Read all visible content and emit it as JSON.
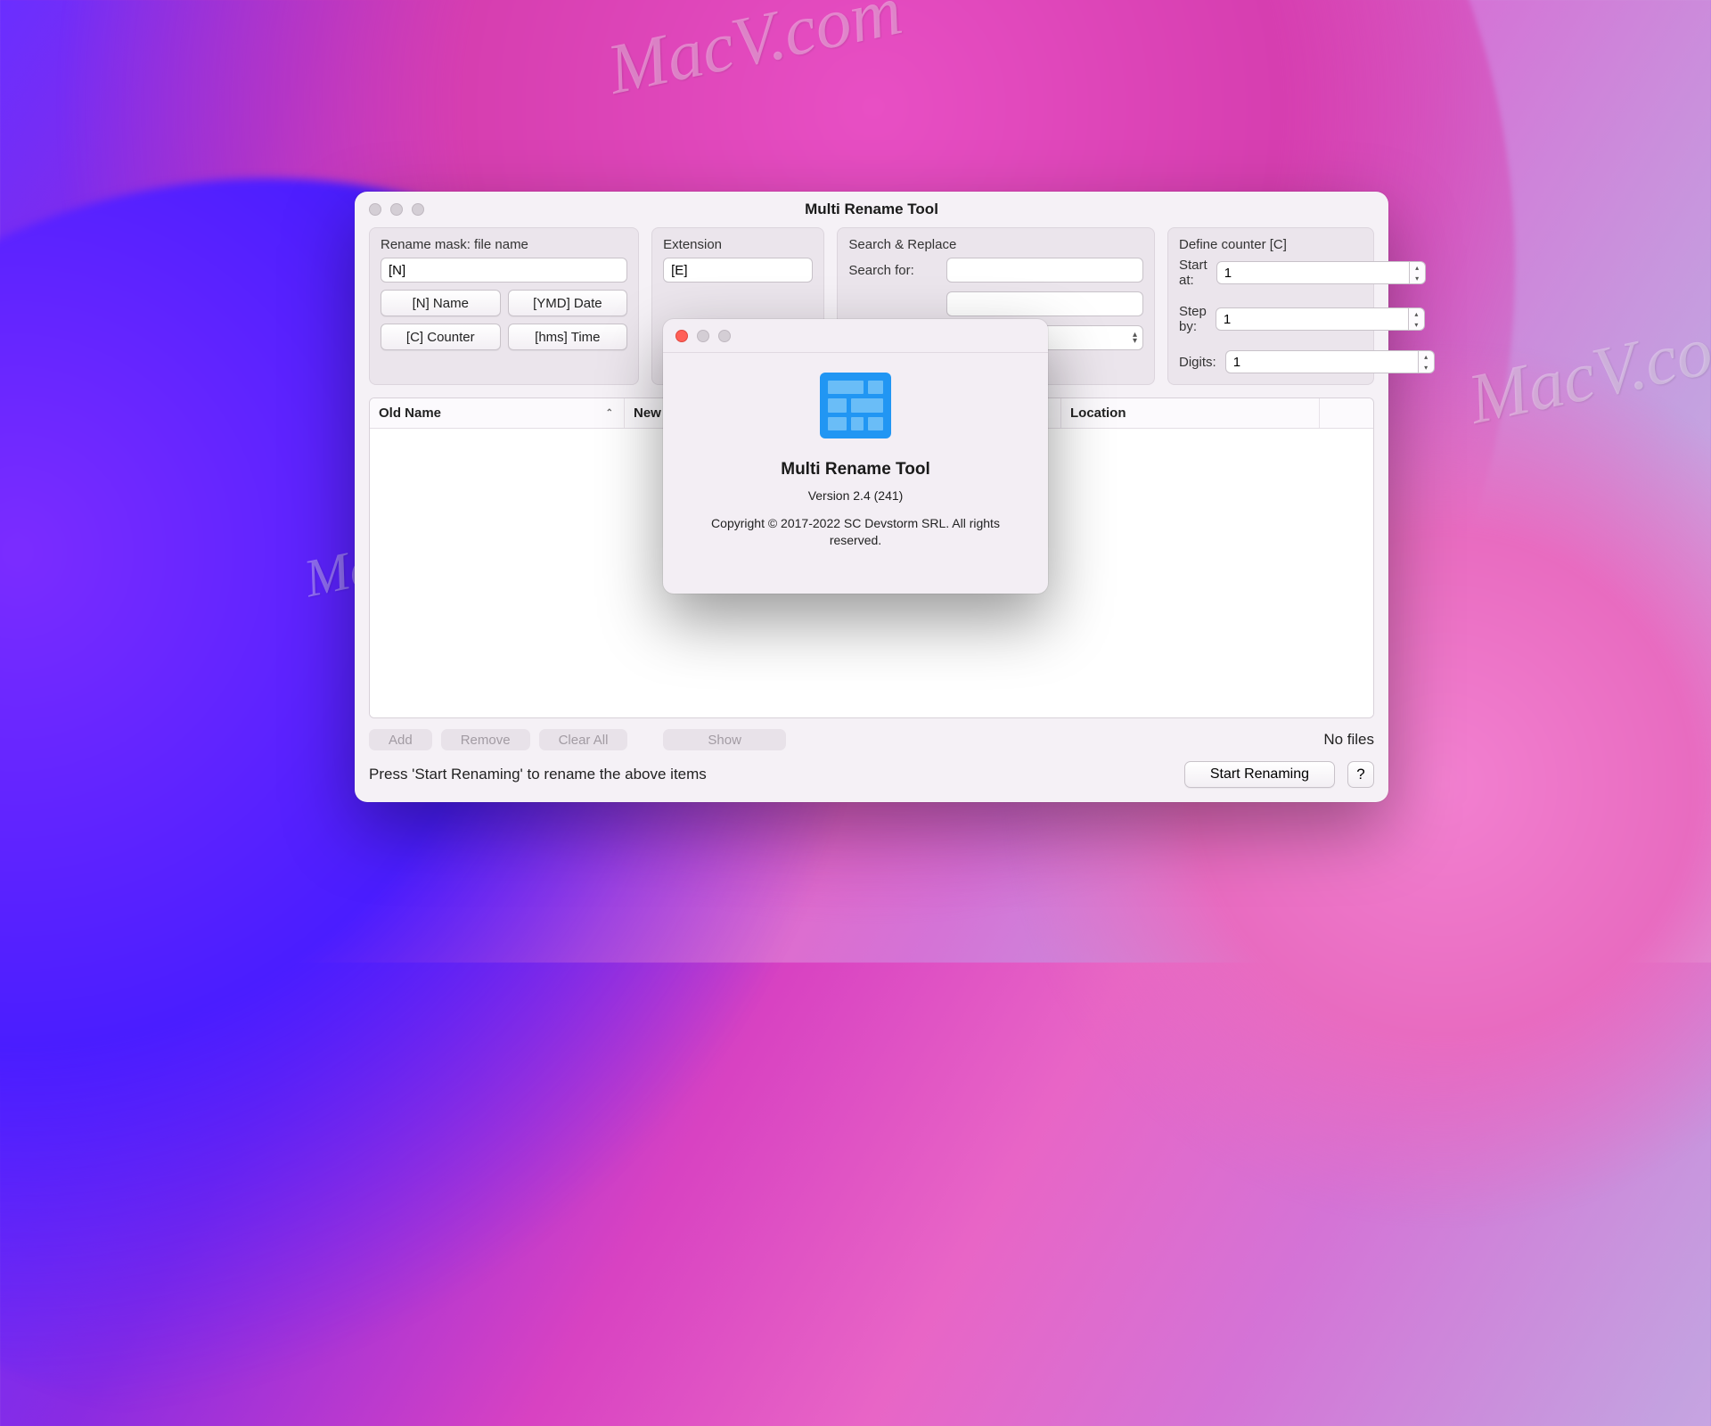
{
  "watermarks": {
    "text": "MacV.com"
  },
  "window": {
    "title": "Multi Rename Tool",
    "panels": {
      "rename_mask": {
        "title": "Rename mask: file name",
        "value": "[N]",
        "buttons": {
          "name": "[N] Name",
          "date": "[YMD] Date",
          "counter": "[C] Counter",
          "time": "[hms] Time"
        }
      },
      "extension": {
        "title": "Extension",
        "value": "[E]"
      },
      "search_replace": {
        "title": "Search & Replace",
        "search_label": "Search for:",
        "search_value": "",
        "replace_value": "",
        "case_value": ""
      },
      "counter": {
        "title": "Define counter [C]",
        "start_label": "Start at:",
        "start_value": "1",
        "step_label": "Step by:",
        "step_value": "1",
        "digits_label": "Digits:",
        "digits_value": "1"
      }
    },
    "table": {
      "columns": {
        "old_name": "Old Name",
        "new_name": "New",
        "location": "Location"
      }
    },
    "bottom": {
      "add": "Add",
      "remove": "Remove",
      "clear_all": "Clear All",
      "show": "Show",
      "no_files": "No files"
    },
    "footer": {
      "hint": "Press 'Start Renaming' to rename the above items",
      "start": "Start Renaming",
      "help": "?"
    }
  },
  "about": {
    "title": "Multi Rename Tool",
    "version": "Version 2.4 (241)",
    "copyright": "Copyright © 2017-2022 SC Devstorm SRL. All rights reserved."
  }
}
